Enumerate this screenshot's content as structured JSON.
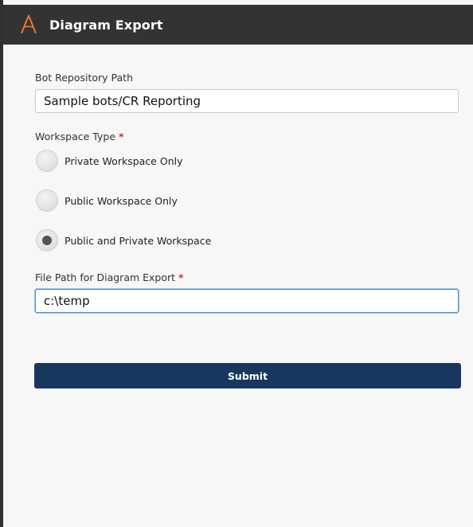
{
  "window": {
    "title": "Diagram Export",
    "logo_icon": "automation-logo-icon",
    "logo_color": "#e8772e",
    "titlebar_color": "#333333"
  },
  "form": {
    "repo_path": {
      "label": "Bot Repository Path",
      "value": "Sample bots/CR Reporting"
    },
    "workspace_type": {
      "label": "Workspace Type",
      "required_mark": "*",
      "options": [
        {
          "label": "Private Workspace Only",
          "selected": false
        },
        {
          "label": "Public Workspace Only",
          "selected": false
        },
        {
          "label": "Public and Private Workspace",
          "selected": true
        }
      ]
    },
    "export_path": {
      "label": "File Path for Diagram Export",
      "required_mark": "*",
      "value": "c:\\temp"
    },
    "submit_label": "Submit",
    "submit_color": "#18375f",
    "required_color": "#d32f2f"
  }
}
